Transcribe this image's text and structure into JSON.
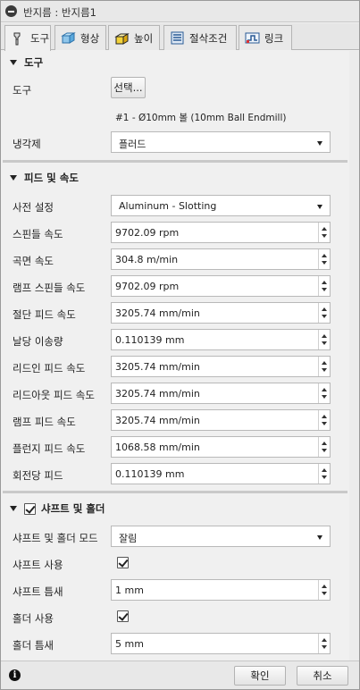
{
  "title": "반지름 : 반지름1",
  "tabs": [
    {
      "label": "도구",
      "icon": "tool-icon",
      "active": true
    },
    {
      "label": "형상",
      "icon": "geometry-icon"
    },
    {
      "label": "높이",
      "icon": "heights-icon"
    },
    {
      "label": "절삭조건",
      "icon": "passes-icon"
    },
    {
      "label": "링크",
      "icon": "linking-icon"
    }
  ],
  "tool_section": {
    "header": "도구",
    "tool_label": "도구",
    "select_button": "선택...",
    "tool_desc": "#1 - Ø10mm 볼 (10mm Ball Endmill)",
    "coolant_label": "냉각제",
    "coolant_value": "플러드"
  },
  "feed_section": {
    "header": "피드 및 속도",
    "preset_label": "사전 설정",
    "preset_value": "Aluminum - Slotting",
    "rows": [
      {
        "label": "스핀들 속도",
        "value": "9702.09 rpm"
      },
      {
        "label": "곡면 속도",
        "value": "304.8 m/min"
      },
      {
        "label": "램프 스핀들 속도",
        "value": "9702.09 rpm"
      },
      {
        "label": "절단 피드 속도",
        "value": "3205.74 mm/min"
      },
      {
        "label": "날당 이송량",
        "value": "0.110139 mm"
      },
      {
        "label": "리드인 피드 속도",
        "value": "3205.74 mm/min"
      },
      {
        "label": "리드아웃 피드 속도",
        "value": "3205.74 mm/min"
      },
      {
        "label": "램프 피드 속도",
        "value": "3205.74 mm/min"
      },
      {
        "label": "플런지 피드 속도",
        "value": "1068.58 mm/min"
      },
      {
        "label": "회전당 피드",
        "value": "0.110139 mm"
      }
    ]
  },
  "holder_section": {
    "header": "샤프트 및 홀더",
    "mode_label": "샤프트 및 홀더 모드",
    "mode_value": "잘림",
    "use_shaft_label": "샤프트 사용",
    "shaft_clearance_label": "샤프트 틈새",
    "shaft_clearance_value": "1 mm",
    "use_holder_label": "홀더 사용",
    "holder_clearance_label": "홀더 틈새",
    "holder_clearance_value": "5 mm"
  },
  "footer": {
    "ok": "확인",
    "cancel": "취소"
  }
}
